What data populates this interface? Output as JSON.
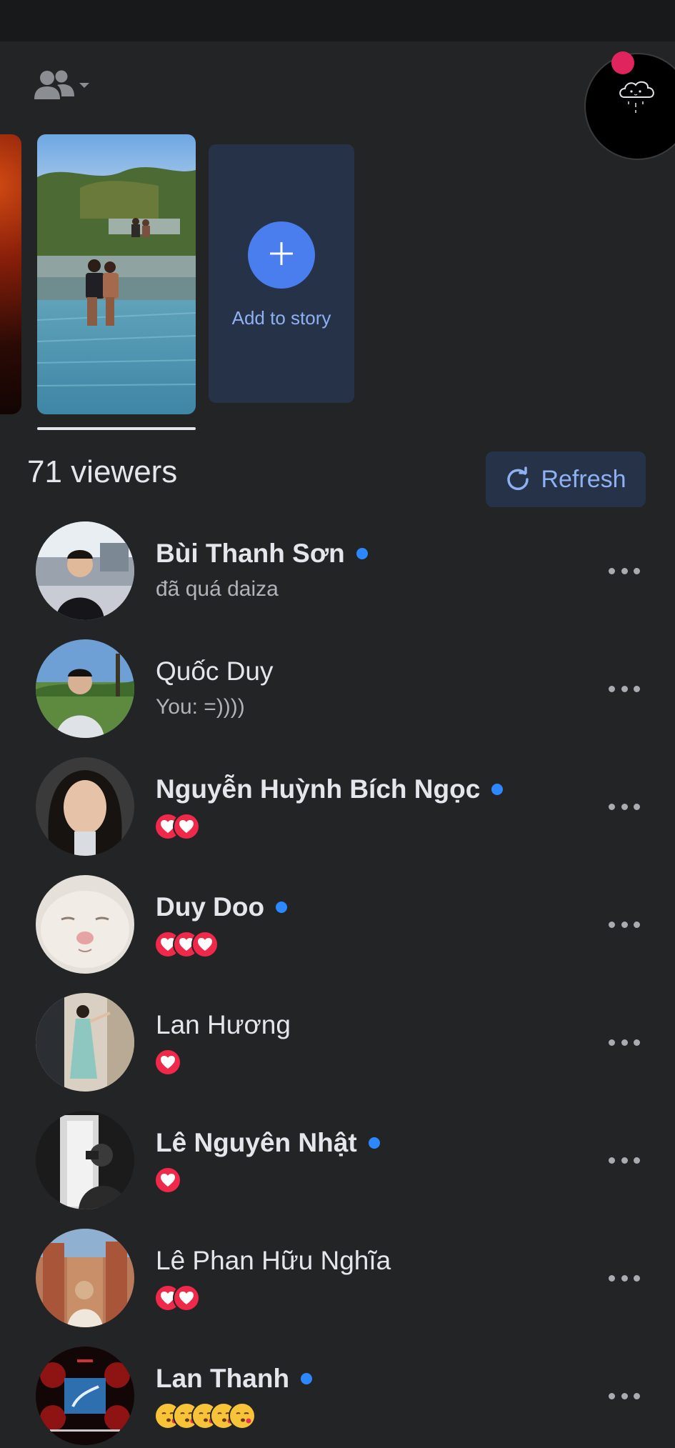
{
  "header": {
    "audience_icon": "people-icon",
    "dropdown_icon": "caret-down-icon"
  },
  "floating_bubble": {
    "icon": "cloud-face-icon",
    "badge_color": "#e0245e"
  },
  "stories": {
    "add_story_label": "Add to story",
    "add_icon": "plus-icon"
  },
  "viewers": {
    "count_text": "71 viewers",
    "refresh_label": "Refresh",
    "refresh_icon": "refresh-icon",
    "accent_color": "#2d88ff",
    "items": [
      {
        "name": "Bùi Thanh Sơn",
        "online": true,
        "bold": true,
        "subtitle": "đã quá daiza",
        "reactions": []
      },
      {
        "name": "Quốc Duy",
        "online": false,
        "bold": false,
        "subtitle": "You: =))))",
        "reactions": []
      },
      {
        "name": "Nguyễn Huỳnh Bích Ngọc",
        "online": true,
        "bold": true,
        "subtitle": "",
        "reactions": [
          "heart",
          "heart"
        ]
      },
      {
        "name": "Duy Doo",
        "online": true,
        "bold": true,
        "subtitle": "",
        "reactions": [
          "heart",
          "heart",
          "heart"
        ]
      },
      {
        "name": "Lan Hương",
        "online": false,
        "bold": false,
        "subtitle": "",
        "reactions": [
          "heart"
        ]
      },
      {
        "name": "Lê Nguyên Nhật",
        "online": true,
        "bold": true,
        "subtitle": "",
        "reactions": [
          "heart"
        ]
      },
      {
        "name": "Lê Phan Hữu Nghĩa",
        "online": false,
        "bold": false,
        "subtitle": "",
        "reactions": [
          "heart",
          "heart"
        ]
      },
      {
        "name": "Lan Thanh",
        "online": true,
        "bold": true,
        "subtitle": "",
        "reactions": [
          "kiss",
          "kiss",
          "kiss",
          "kiss",
          "kiss"
        ]
      }
    ]
  }
}
